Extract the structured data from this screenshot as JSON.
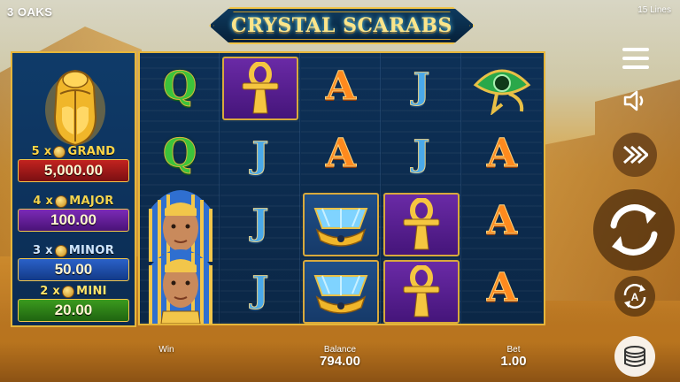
{
  "header": {
    "brand": "3 OAKS",
    "lines": "15 Lines",
    "logo_text": "CRYSTAL SCARABS"
  },
  "jackpots": [
    {
      "multiplier": "5 x",
      "name": "GRAND",
      "value": "5,000.00",
      "color": "#c2231f"
    },
    {
      "multiplier": "4 x",
      "name": "MAJOR",
      "value": "100.00",
      "color": "#7b2ab7"
    },
    {
      "multiplier": "3 x",
      "name": "MINOR",
      "value": "50.00",
      "color": "#2a61c9"
    },
    {
      "multiplier": "2 x",
      "name": "MINI",
      "value": "20.00",
      "color": "#3b9a1e"
    }
  ],
  "reels": [
    [
      "Q",
      "Q",
      "pharaoh",
      "pharaoh"
    ],
    [
      "ankh",
      "J",
      "J",
      "J"
    ],
    [
      "A",
      "A",
      "lotus",
      "lotus"
    ],
    [
      "J",
      "J",
      "ankh",
      "ankh"
    ],
    [
      "eye-of-horus",
      "A",
      "A",
      "A"
    ]
  ],
  "footer": {
    "win_label": "Win",
    "balance_label": "Balance",
    "balance_value": "794.00",
    "bet_label": "Bet",
    "bet_value": "1.00"
  },
  "buttons": {
    "menu": "menu-icon",
    "sound": "speaker-icon",
    "turbo": "fast-forward-icon",
    "spin": "spin-arrows-icon",
    "autoplay": "autoplay-icon",
    "bet": "coin-stack-icon"
  }
}
